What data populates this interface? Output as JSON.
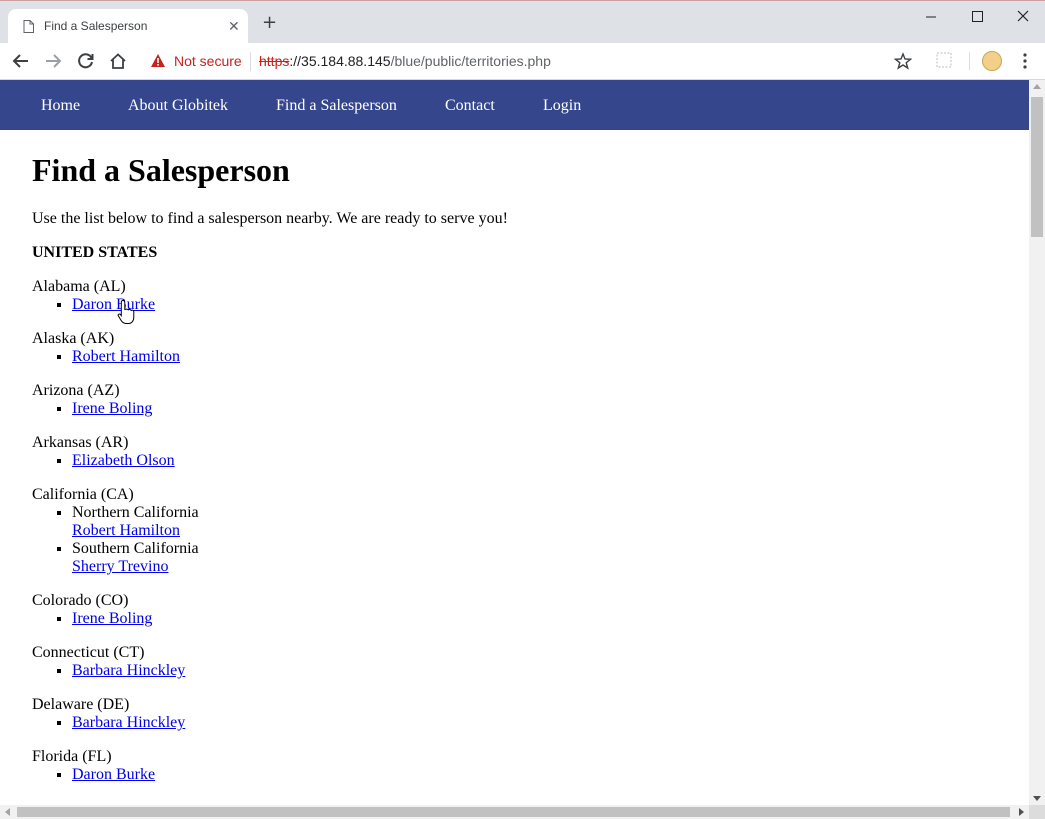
{
  "browser": {
    "tab_title": "Find a Salesperson",
    "tab_close": "✕",
    "new_tab": "+",
    "security_label": "Not secure",
    "url_scheme": "https",
    "url_rest": "://35.184.88.145",
    "url_path": "/blue/public/territories.php"
  },
  "nav": {
    "home": "Home",
    "about": "About Globitek",
    "find": "Find a Salesperson",
    "contact": "Contact",
    "login": "Login",
    "bg_color": "#35468c"
  },
  "page": {
    "title": "Find a Salesperson",
    "intro": "Use the list below to find a salesperson nearby. We are ready to serve you!",
    "country": "UNITED STATES"
  },
  "states": [
    {
      "name": "Alabama (AL)",
      "items": [
        {
          "region": "",
          "person": "Daron Burke"
        }
      ]
    },
    {
      "name": "Alaska (AK)",
      "items": [
        {
          "region": "",
          "person": "Robert Hamilton"
        }
      ]
    },
    {
      "name": "Arizona (AZ)",
      "items": [
        {
          "region": "",
          "person": "Irene Boling"
        }
      ]
    },
    {
      "name": "Arkansas (AR)",
      "items": [
        {
          "region": "",
          "person": "Elizabeth Olson"
        }
      ]
    },
    {
      "name": "California (CA)",
      "items": [
        {
          "region": "Northern California",
          "person": "Robert Hamilton"
        },
        {
          "region": "Southern California",
          "person": "Sherry Trevino"
        }
      ]
    },
    {
      "name": "Colorado (CO)",
      "items": [
        {
          "region": "",
          "person": "Irene Boling"
        }
      ]
    },
    {
      "name": "Connecticut (CT)",
      "items": [
        {
          "region": "",
          "person": "Barbara Hinckley"
        }
      ]
    },
    {
      "name": "Delaware (DE)",
      "items": [
        {
          "region": "",
          "person": "Barbara Hinckley"
        }
      ]
    },
    {
      "name": "Florida (FL)",
      "items": [
        {
          "region": "",
          "person": "Daron Burke"
        }
      ]
    }
  ]
}
